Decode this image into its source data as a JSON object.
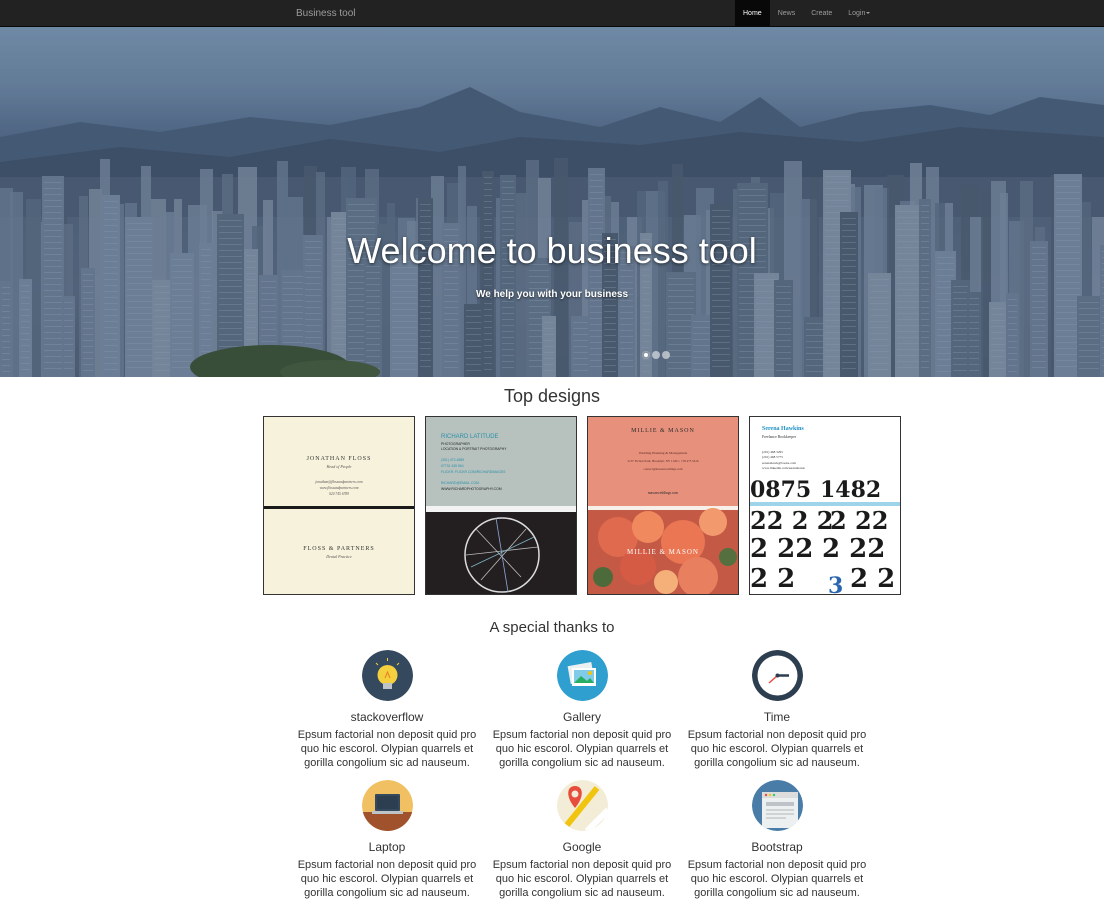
{
  "navbar": {
    "brand": "Business tool",
    "links": [
      {
        "label": "Home",
        "active": true
      },
      {
        "label": "News",
        "active": false
      },
      {
        "label": "Create",
        "active": false
      },
      {
        "label": "Login",
        "active": false,
        "dropdown": true
      }
    ]
  },
  "hero": {
    "title": "Welcome to business tool",
    "subtitle": "We help you with your business",
    "slides": 3,
    "active_slide": 1
  },
  "top_designs": {
    "title": "Top designs",
    "cards": [
      {
        "name": "JONATHAN FLOSS",
        "role": "Head of People",
        "lines": [
          "jonathan@flossandpartners.com",
          "www.flossandpartners.com",
          "020 745 6789"
        ],
        "company": "FLOSS & PARTNERS",
        "tagline": "Dental Practice"
      },
      {
        "name": "RICHARD LATITUDE",
        "lines": [
          "PHOTOGRAPHER",
          "LOCATION & PORTRAIT PHOTOGRAPHY",
          "(301) 472-4589",
          "07731 435 564",
          "FLICKR: FLICKR.COM/RICHARDIMAGES",
          "RICHARD@EMAIL.COM",
          "WWW.RICHARDPHOTOGRAPHY.COM"
        ]
      },
      {
        "name": "MILLIE & MASON",
        "lines": [
          "Wedding Planning & Management",
          "2137 Fiction Park, Brooklyn, NY 11201 | 718 475 5416",
          "contact@masonweddings.com",
          "masonweddings.com"
        ],
        "overlay": "MILLIE & MASON"
      },
      {
        "name": "Serena Hawkins",
        "role": "Freelance Bookkeeper",
        "lines": [
          "(201) 468 3295",
          "(201) 468 5775",
          "serenahawk@books.com",
          "www.linkedin.com/serenahawk"
        ]
      }
    ]
  },
  "thanks": {
    "title": "A special thanks to",
    "items": [
      {
        "name": "stackoverflow",
        "icon": "lightbulb-icon",
        "text": "Epsum factorial non deposit quid pro quo hic escorol. Olypian quarrels et gorilla congolium sic ad nauseum."
      },
      {
        "name": "Gallery",
        "icon": "gallery-icon",
        "text": "Epsum factorial non deposit quid pro quo hic escorol. Olypian quarrels et gorilla congolium sic ad nauseum."
      },
      {
        "name": "Time",
        "icon": "clock-icon",
        "text": "Epsum factorial non deposit quid pro quo hic escorol. Olypian quarrels et gorilla congolium sic ad nauseum."
      },
      {
        "name": "Laptop",
        "icon": "laptop-icon",
        "text": "Epsum factorial non deposit quid pro quo hic escorol. Olypian quarrels et gorilla congolium sic ad nauseum."
      },
      {
        "name": "Google",
        "icon": "map-pin-icon",
        "text": "Epsum factorial non deposit quid pro quo hic escorol. Olypian quarrels et gorilla congolium sic ad nauseum."
      },
      {
        "name": "Bootstrap",
        "icon": "browser-window-icon",
        "text": "Epsum factorial non deposit quid pro quo hic escorol. Olypian quarrels et gorilla congolium sic ad nauseum."
      }
    ]
  }
}
